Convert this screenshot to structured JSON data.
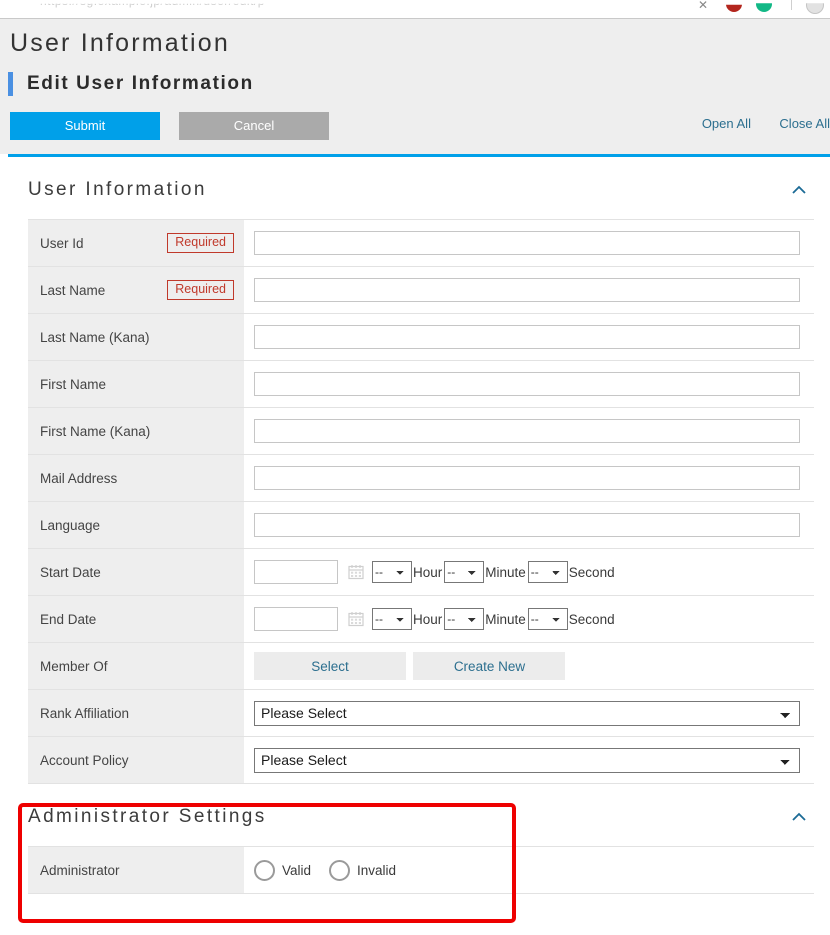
{
  "browser": {
    "url_ghost": "https://sg.example.jp/admin/user/edit/p",
    "tab_close_icon": "close-icon",
    "profile_icons": [
      "red-badge-icon",
      "green-badge-icon",
      "avatar-icon"
    ]
  },
  "header": {
    "page_title": "User Information",
    "section_heading": "Edit User Information"
  },
  "actions": {
    "submit_label": "Submit",
    "cancel_label": "Cancel",
    "open_all_label": "Open All",
    "close_all_label": "Close All"
  },
  "panels": [
    {
      "title": "User Information",
      "collapse_icon": "chevron-up-icon",
      "rows": [
        {
          "label": "User Id",
          "required": "Required",
          "control": "text"
        },
        {
          "label": "Last Name",
          "required": "Required",
          "control": "text"
        },
        {
          "label": "Last Name (Kana)",
          "required": "",
          "control": "text"
        },
        {
          "label": "First Name",
          "required": "",
          "control": "text"
        },
        {
          "label": "First Name (Kana)",
          "required": "",
          "control": "text"
        },
        {
          "label": "Mail Address",
          "required": "",
          "control": "text"
        },
        {
          "label": "Language",
          "required": "",
          "control": "text"
        },
        {
          "label": "Start Date",
          "required": "",
          "control": "datetime"
        },
        {
          "label": "End Date",
          "required": "",
          "control": "datetime"
        },
        {
          "label": "Member Of",
          "required": "",
          "control": "buttons"
        },
        {
          "label": "Rank Affiliation",
          "required": "",
          "control": "select"
        },
        {
          "label": "Account Policy",
          "required": "",
          "control": "select"
        }
      ]
    },
    {
      "title": "Administrator Settings",
      "collapse_icon": "chevron-up-icon",
      "rows": [
        {
          "label": "Administrator",
          "required": "",
          "control": "radio"
        }
      ]
    }
  ],
  "datetime": {
    "date_value": "",
    "date_placeholder": "",
    "calendar_icon": "calendar-icon",
    "hour_value": "--",
    "hour_unit": "Hour",
    "minute_value": "--",
    "minute_unit": "Minute",
    "second_value": "--",
    "second_unit": "Second"
  },
  "member_of": {
    "select_label": "Select",
    "create_new_label": "Create New"
  },
  "selects": {
    "placeholder_option": "Please Select"
  },
  "administrator": {
    "valid_label": "Valid",
    "invalid_label": "Invalid",
    "selected": ""
  },
  "annotation": {
    "color": "#ee0000",
    "target": "Administrator Settings"
  },
  "colors": {
    "accent_blue": "#00a0e9",
    "heading_bar_blue": "#4a90e2",
    "link_blue": "#2c6f8f",
    "required_red": "#c0392b",
    "cancel_gray": "#aaaaaa",
    "label_bg": "#eeeeee"
  }
}
